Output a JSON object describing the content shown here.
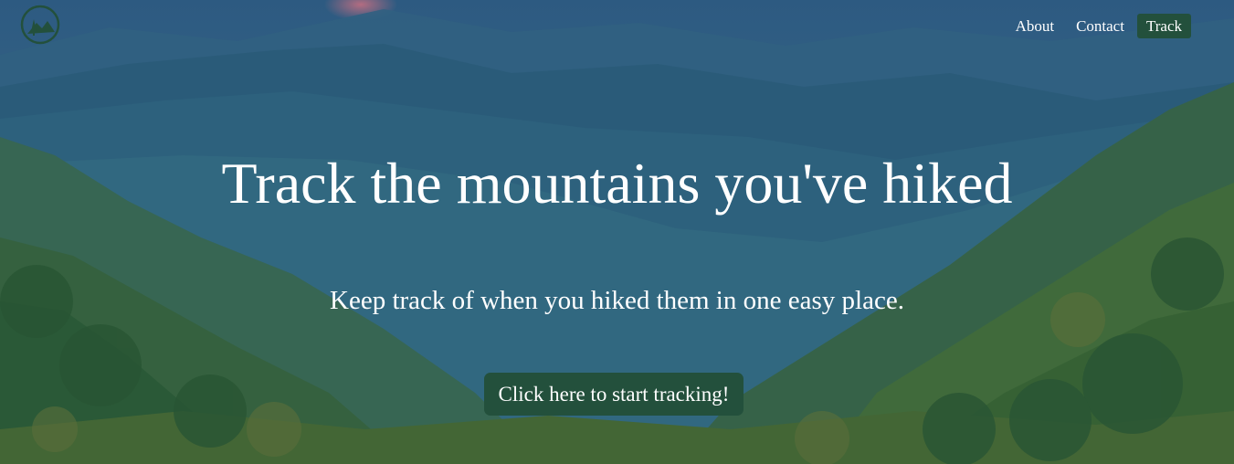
{
  "logo": {
    "icon": "mountain-tree-logo-icon"
  },
  "nav": {
    "items": [
      {
        "label": "About"
      },
      {
        "label": "Contact"
      },
      {
        "label": "Track"
      }
    ]
  },
  "hero": {
    "headline": "Track the mountains you've hiked",
    "subheadline": "Keep track of when you hiked them in one easy place.",
    "cta_label": "Click here to start tracking!"
  },
  "colors": {
    "accent": "#23503c",
    "text": "#ffffff",
    "sky": "#2f5f85"
  }
}
